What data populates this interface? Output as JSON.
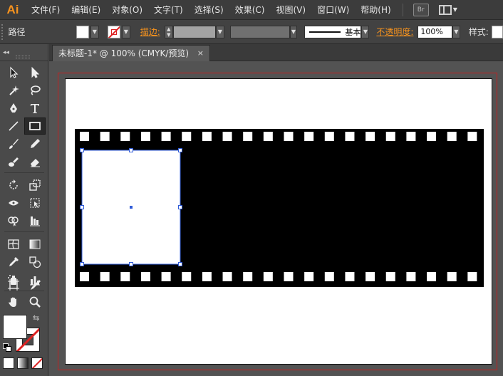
{
  "app": {
    "logo": "Ai"
  },
  "menu": {
    "items": [
      "文件(F)",
      "编辑(E)",
      "对象(O)",
      "文字(T)",
      "选择(S)",
      "效果(C)",
      "视图(V)",
      "窗口(W)",
      "帮助(H)"
    ],
    "bridge_label": "Br"
  },
  "control": {
    "path_label": "路径",
    "stroke_link": "描边:",
    "brush_label": "基本",
    "opacity_link": "不透明度:",
    "opacity_value": "100%",
    "style_label": "样式:"
  },
  "document": {
    "tab_title": "未标题-1* @ 100% (CMYK/预览)",
    "close_glyph": "×"
  },
  "toolbox": {
    "collapse_glyph": "◂◂",
    "active_tool": "rectangle-tool",
    "tools": [
      [
        "selection-tool",
        "direct-selection-tool"
      ],
      [
        "magic-wand-tool",
        "lasso-tool"
      ],
      [
        "pen-tool",
        "type-tool"
      ],
      [
        "line-segment-tool",
        "rectangle-tool"
      ],
      [
        "paintbrush-tool",
        "pencil-tool"
      ],
      [
        "blob-brush-tool",
        "eraser-tool"
      ],
      [
        "rotate-tool",
        "scale-tool"
      ],
      [
        "width-tool",
        "free-transform-tool"
      ],
      [
        "shape-builder-tool",
        "perspective-grid-tool"
      ],
      [
        "mesh-tool",
        "gradient-tool"
      ],
      [
        "eyedropper-tool",
        "blend-tool"
      ],
      [
        "symbol-sprayer-tool",
        "column-graph-tool"
      ],
      [
        "artboard-tool",
        "slice-tool"
      ],
      [
        "hand-tool",
        "zoom-tool"
      ]
    ],
    "swap_glyph": "⇆"
  },
  "colors": {
    "accent_orange": "#f7931e",
    "artboard_border": "#c42121",
    "selection_blue": "#2f5bd8",
    "film_black": "#000000",
    "film_hole": "#ffffff"
  },
  "artwork": {
    "film_perforations_per_row": 20,
    "selected_object": "white-rectangle"
  }
}
